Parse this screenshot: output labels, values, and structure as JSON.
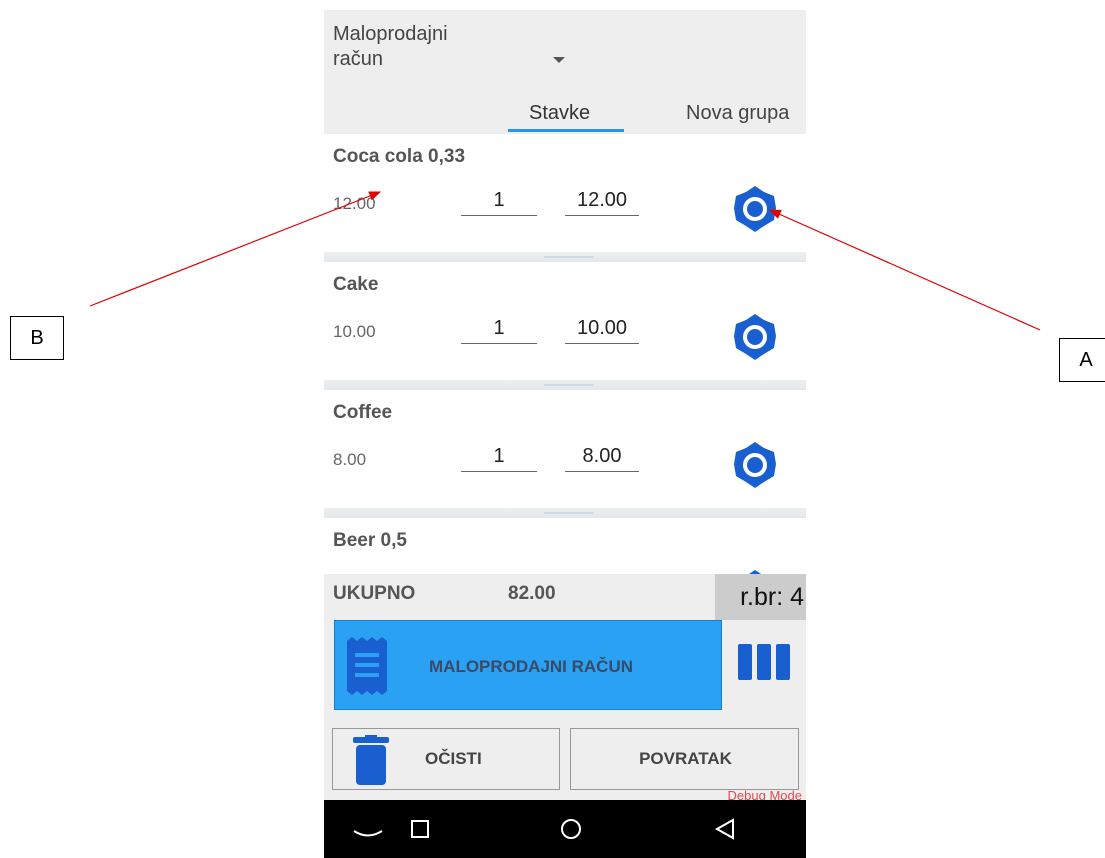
{
  "header": {
    "document_type": "Maloprodajni račun",
    "tabs": [
      {
        "label": "Stavke",
        "active": true
      },
      {
        "label": "Nova grupa",
        "active": false
      }
    ]
  },
  "items": [
    {
      "name": "Coca cola 0,33",
      "price": "12.00",
      "qty": "1",
      "total": "12.00"
    },
    {
      "name": "Cake",
      "price": "10.00",
      "qty": "1",
      "total": "10.00"
    },
    {
      "name": "Coffee",
      "price": "8.00",
      "qty": "1",
      "total": "8.00"
    },
    {
      "name": "Beer 0,5",
      "price": "",
      "qty": "",
      "total": ""
    }
  ],
  "summary": {
    "total_label": "UKUPNO",
    "total_value": "82.00",
    "counter": "r.br: 4"
  },
  "actions": {
    "receipt_label": "MALOPRODAJNI RAČUN",
    "clear_label": "OČISTI",
    "back_label": "POVRATAK",
    "debug": "Debug Mode"
  },
  "icons": {
    "gear": "gear-icon",
    "receipt": "receipt-icon",
    "trash": "trash-icon",
    "more": "more-icon",
    "nav": [
      "nav-back-icon",
      "nav-square-icon",
      "nav-circle-icon",
      "nav-triangle-icon"
    ]
  },
  "annotations": {
    "a_label": "A",
    "b_label": "B"
  },
  "colors": {
    "accent": "#2196f3",
    "receipt_button": "#2aa1f3",
    "icon_blue": "#1a5fd0",
    "annotation_arrow": "#e00000",
    "debug_text": "#e84a4a"
  }
}
